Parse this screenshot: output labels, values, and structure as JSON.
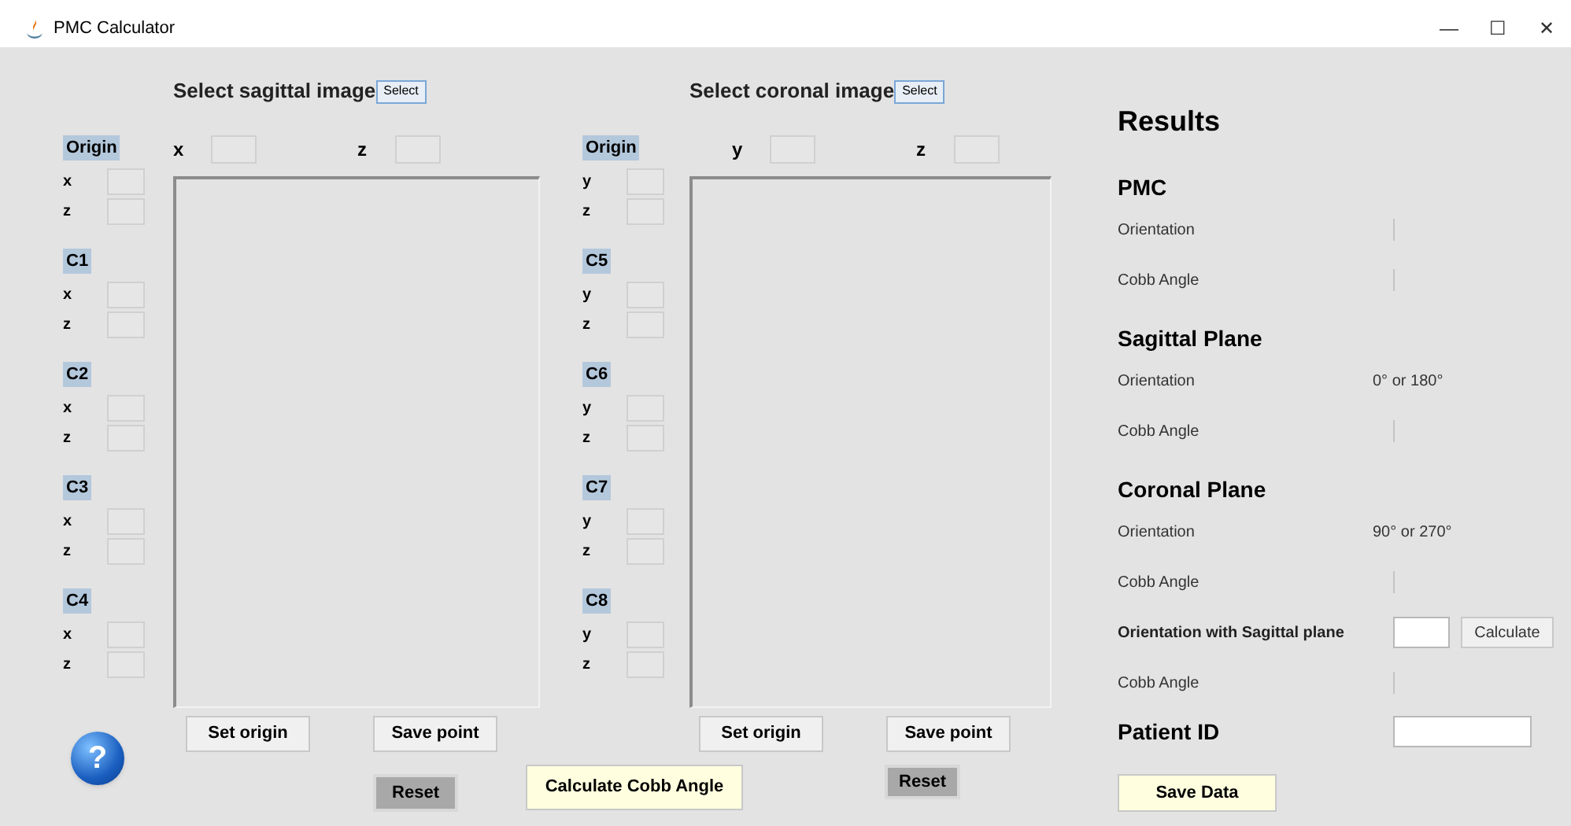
{
  "window": {
    "title": "PMC Calculator",
    "controls": [
      "—",
      "☐",
      "✕"
    ]
  },
  "sagittal": {
    "heading": "Select sagittal image",
    "select_button": "Select",
    "coords": [
      "x",
      "z"
    ],
    "markers": [
      {
        "label": "Origin",
        "axes": [
          "x",
          "z"
        ]
      },
      {
        "label": "C1",
        "axes": [
          "x",
          "z"
        ]
      },
      {
        "label": "C2",
        "axes": [
          "x",
          "z"
        ]
      },
      {
        "label": "C3",
        "axes": [
          "x",
          "z"
        ]
      },
      {
        "label": "C4",
        "axes": [
          "x",
          "z"
        ]
      }
    ],
    "set_origin": "Set origin",
    "save_point": "Save point",
    "reset": "Reset"
  },
  "coronal": {
    "heading": "Select coronal image",
    "select_button": "Select",
    "coords": [
      "y",
      "z"
    ],
    "markers": [
      {
        "label": "Origin",
        "axes": [
          "y",
          "z"
        ]
      },
      {
        "label": "C5",
        "axes": [
          "y",
          "z"
        ]
      },
      {
        "label": "C6",
        "axes": [
          "y",
          "z"
        ]
      },
      {
        "label": "C7",
        "axes": [
          "y",
          "z"
        ]
      },
      {
        "label": "C8",
        "axes": [
          "y",
          "z"
        ]
      }
    ],
    "set_origin": "Set origin",
    "save_point": "Save point",
    "reset": "Reset"
  },
  "help_button": "?",
  "calculate_button": "Calculate Cobb Angle",
  "results": {
    "title": "Results",
    "sections": [
      {
        "heading": "PMC",
        "rows": [
          {
            "kind": "value",
            "label": "Orientation"
          },
          {
            "kind": "value",
            "label": "Cobb Angle"
          }
        ]
      },
      {
        "heading": "Sagittal Plane",
        "rows": [
          {
            "kind": "value",
            "label": "Orientation",
            "value": "0° or 180°"
          },
          {
            "kind": "value",
            "label": "Cobb Angle"
          }
        ]
      },
      {
        "heading": "Coronal Plane",
        "rows": [
          {
            "kind": "value",
            "label": "Orientation",
            "value": "90° or 270°"
          },
          {
            "kind": "value",
            "label": "Cobb Angle"
          },
          {
            "kind": "input",
            "label": "Orientation with Sagittal plane",
            "button": "Calculate"
          },
          {
            "kind": "value",
            "label": "Cobb Angle"
          }
        ]
      }
    ],
    "patient_id": "Patient ID",
    "save_button": "Save Data"
  }
}
